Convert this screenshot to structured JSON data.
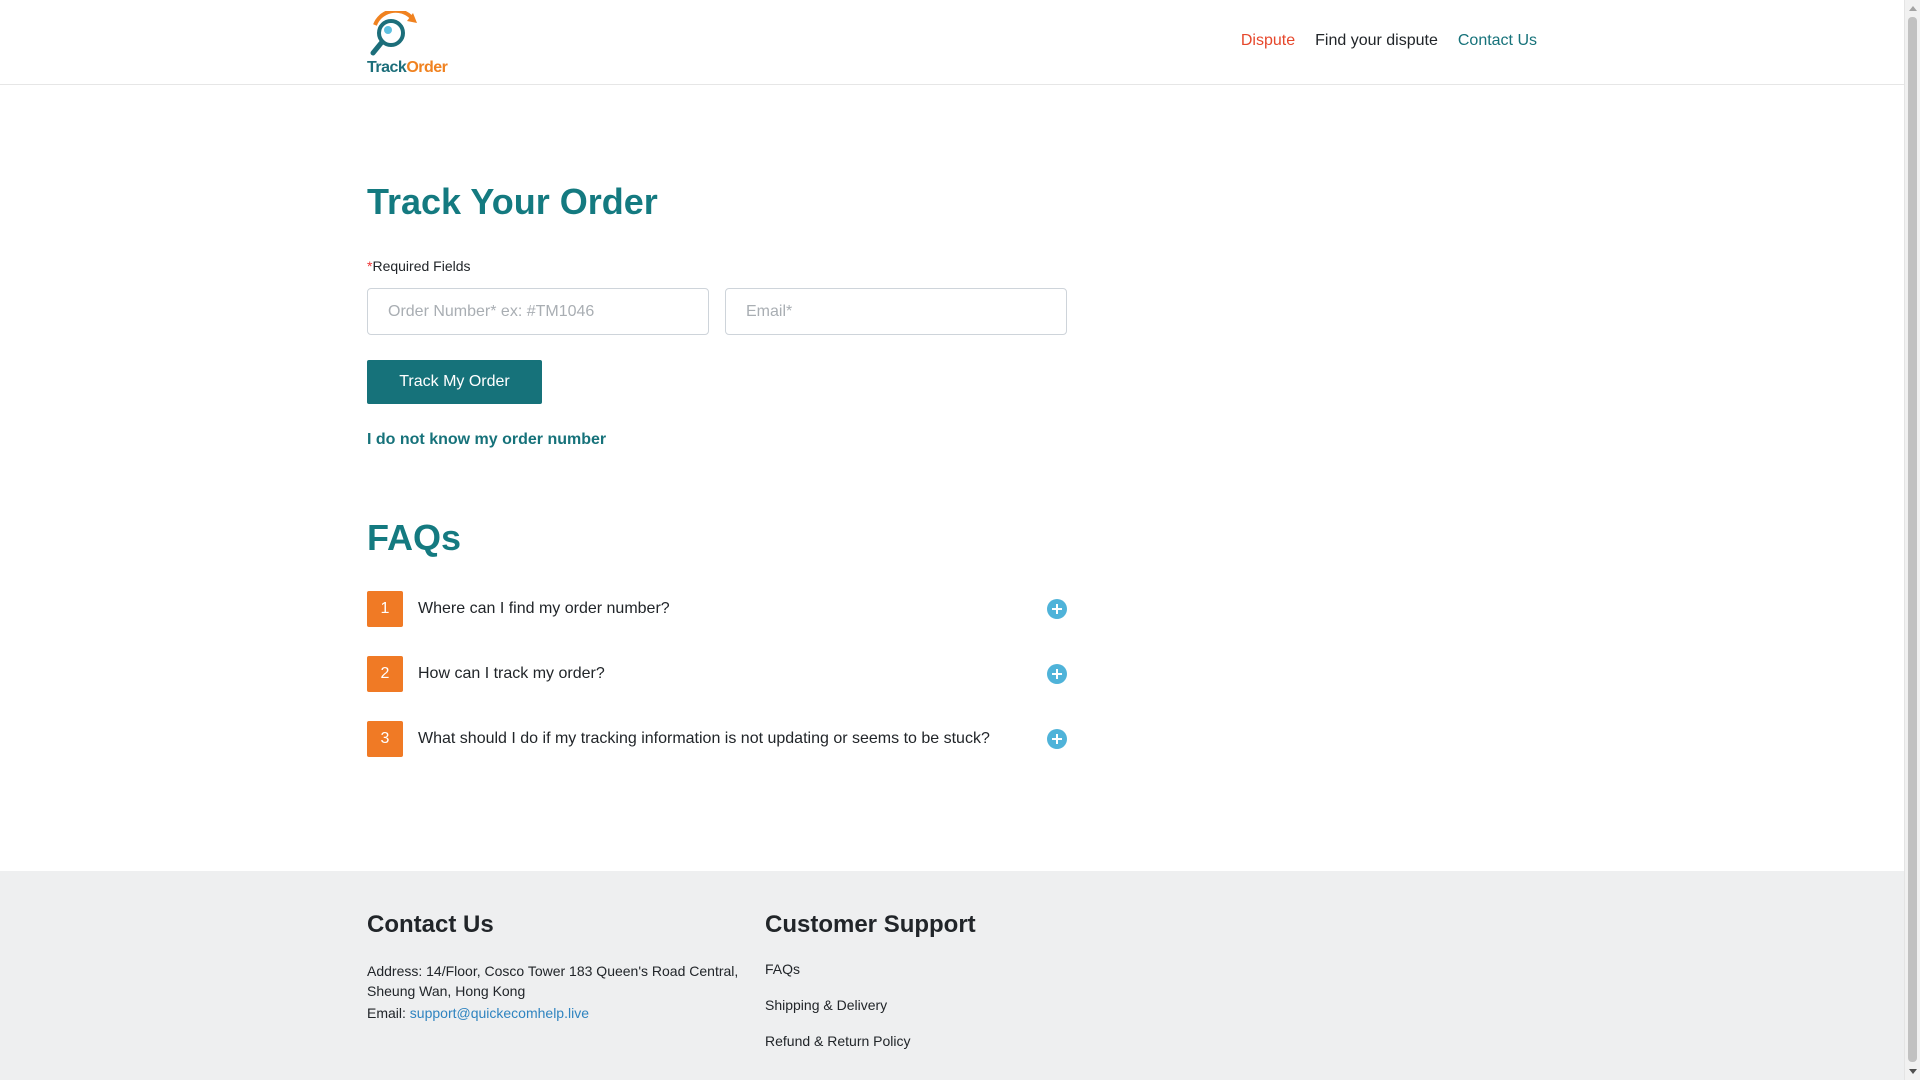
{
  "header": {
    "logo": {
      "text_part1": "Track",
      "text_part2": "Order",
      "icon": "magnifier-arrow-icon"
    },
    "nav": [
      {
        "label": "Dispute",
        "color": "#e6472b"
      },
      {
        "label": "Find your dispute",
        "color": "#212529"
      },
      {
        "label": "Contact Us",
        "color": "#16727a"
      }
    ]
  },
  "main": {
    "title": "Track Your Order",
    "required_star": "*",
    "required_label": "Required Fields",
    "order_input": {
      "placeholder": "Order Number* ex: #TM1046",
      "value": ""
    },
    "email_input": {
      "placeholder": "Email*",
      "value": ""
    },
    "track_button": "Track My Order",
    "unknown_order_link": "I do not know my order number"
  },
  "faqs": {
    "title": "FAQs",
    "items": [
      {
        "num": "1",
        "question": "Where can I find my order number?"
      },
      {
        "num": "2",
        "question": "How can I track my order?"
      },
      {
        "num": "3",
        "question": "What should I do if my tracking information is not updating or seems to be stuck?"
      }
    ]
  },
  "footer": {
    "contact": {
      "title": "Contact Us",
      "address": "Address: 14/Floor, Cosco Tower 183 Queen's Road Central, Sheung Wan, Hong Kong",
      "email_label": "Email:",
      "email": "support@quickecomhelp.live"
    },
    "support": {
      "title": "Customer Support",
      "links": [
        "FAQs",
        "Shipping & Delivery",
        "Refund & Return Policy"
      ]
    }
  },
  "colors": {
    "accent": "#16727a",
    "faq_number": "#f07a25",
    "plus_icon": "#4fb3d9",
    "footer_bg": "#eeeff0"
  }
}
